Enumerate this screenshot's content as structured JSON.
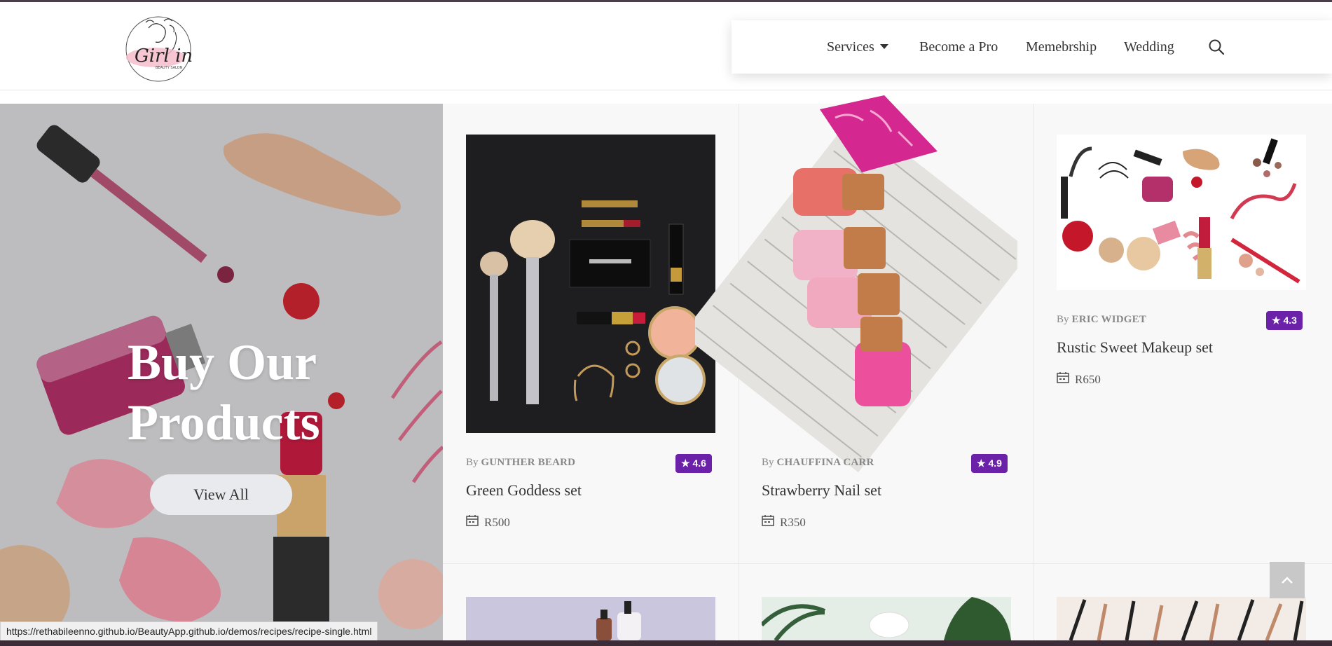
{
  "header": {
    "logo": {
      "brand_text": "Girl in",
      "sub_text": "BEAUTY SALON"
    },
    "nav": [
      {
        "label": "Services",
        "has_dropdown": true
      },
      {
        "label": "Become a Pro"
      },
      {
        "label": "Memebrship"
      },
      {
        "label": "Wedding"
      }
    ],
    "search_icon": "search-icon"
  },
  "hero": {
    "title_line1": "Buy Our",
    "title_line2": "Products",
    "button_label": "View All"
  },
  "products": [
    {
      "by": "By",
      "author": "GUNTHER BEARD",
      "rating": "4.6",
      "title": "Green Goddess set",
      "price": "R500"
    },
    {
      "by": "By",
      "author": "CHAUFFINA CARR",
      "rating": "4.9",
      "title": "Strawberry Nail set",
      "price": "R350"
    },
    {
      "by": "By",
      "author": "ERIC WIDGET",
      "rating": "4.3",
      "title": "Rustic Sweet Makeup set",
      "price": "R650"
    }
  ],
  "status_bar": {
    "url": "https://rethabileenno.github.io/BeautyApp.github.io/demos/recipes/recipe-single.html"
  },
  "colors": {
    "rating_badge": "#6b21a8",
    "hero_text": "#ffffff",
    "button_bg": "#e8eaed"
  },
  "icons": {
    "star": "star-icon",
    "price": "calendar-icon",
    "back_to_top": "chevron-up-icon"
  }
}
